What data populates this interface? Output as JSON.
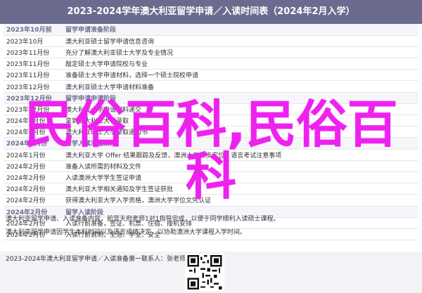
{
  "header": {
    "title": "2023-2024学年澳大利亚留学申请／入读时间表（2024年2月入学）"
  },
  "schedule": [
    {
      "type": "phase",
      "month": "2023年10月前",
      "task": "留学申请准备阶段"
    },
    {
      "type": "row",
      "month": "2023年10月",
      "task": "澳大利亚硕士留学申请信息咨询"
    },
    {
      "type": "row",
      "month": "2023年11月份",
      "task": "充分了解澳大利亚硕士大学及专业情况"
    },
    {
      "type": "row",
      "month": "2023年11月份",
      "task": "敲定硕士大学申请院校与专业"
    },
    {
      "type": "row",
      "month": "2023年11月份",
      "task": "准备硕士大学申请材料，选择一个硕士院校申请"
    },
    {
      "type": "row",
      "month": "2023年12月份",
      "task": "澳大利亚硕士大学申请材料准备"
    },
    {
      "type": "phase",
      "month": "2023年12月份",
      "task": "留学申请申请阶段"
    },
    {
      "type": "row",
      "month": "2023年12月份",
      "task": "澳大利亚大学申请材料递交"
    },
    {
      "type": "row",
      "month": "2024年1月份",
      "task": "拿到澳大利亚大学录取"
    },
    {
      "type": "row",
      "month": "2024年1月份",
      "task": "澳大利亚硕士大学录取通知书"
    },
    {
      "type": "phase",
      "month": "2024年1月份",
      "task": "留学入读准备阶段"
    },
    {
      "type": "row",
      "month": "2024年1月份",
      "task": "澳大利亚大学 Offer 结果跟踪及反馈，澳洲大学初步定位，语言考试注意事项"
    },
    {
      "type": "row",
      "month": "2024年2月份",
      "task": "准备入读所需的材料及文件"
    },
    {
      "type": "row",
      "month": "2024年2月份",
      "task": "入读澳洲大学学生签证申请"
    },
    {
      "type": "row",
      "month": "2024年2月份",
      "task": "澳大利亚大学相关通知及学生签证获批"
    },
    {
      "type": "row",
      "month": "2024年2月份",
      "task": "获得澳大利亚大学入学资格，澳洲大学学位文凭认证"
    },
    {
      "type": "phase",
      "month": "2024年2月份",
      "task": "留学入读阶段"
    },
    {
      "type": "row",
      "month": "2024年2月份",
      "task": "入读行前准备，签证、机票、住宿、接机安排"
    },
    {
      "type": "row",
      "month": "2024年2月份",
      "task": "入读行前说明，生活、学业、安全"
    }
  ],
  "notes": [
    "澳大利亚留学申请、入读准备内容，前蓝天府老师1对1指导完成，以便于同学顺利入读硕士课程。",
    "澳大利亚留学申请因学生本科时间以及语言成绩决定，以协助澳洲大学课程入学时间。"
  ],
  "footer": {
    "text": "2023-2024年澳大利亚留学申请／入读准备第一联系人：张老师"
  },
  "watermark": {
    "line1": "民俗百科,民俗百",
    "line2": "科"
  },
  "colors": {
    "header": "#6b6b8f",
    "watermark": "#ee22ee"
  },
  "icons": {
    "qr": "qr-code-icon"
  }
}
